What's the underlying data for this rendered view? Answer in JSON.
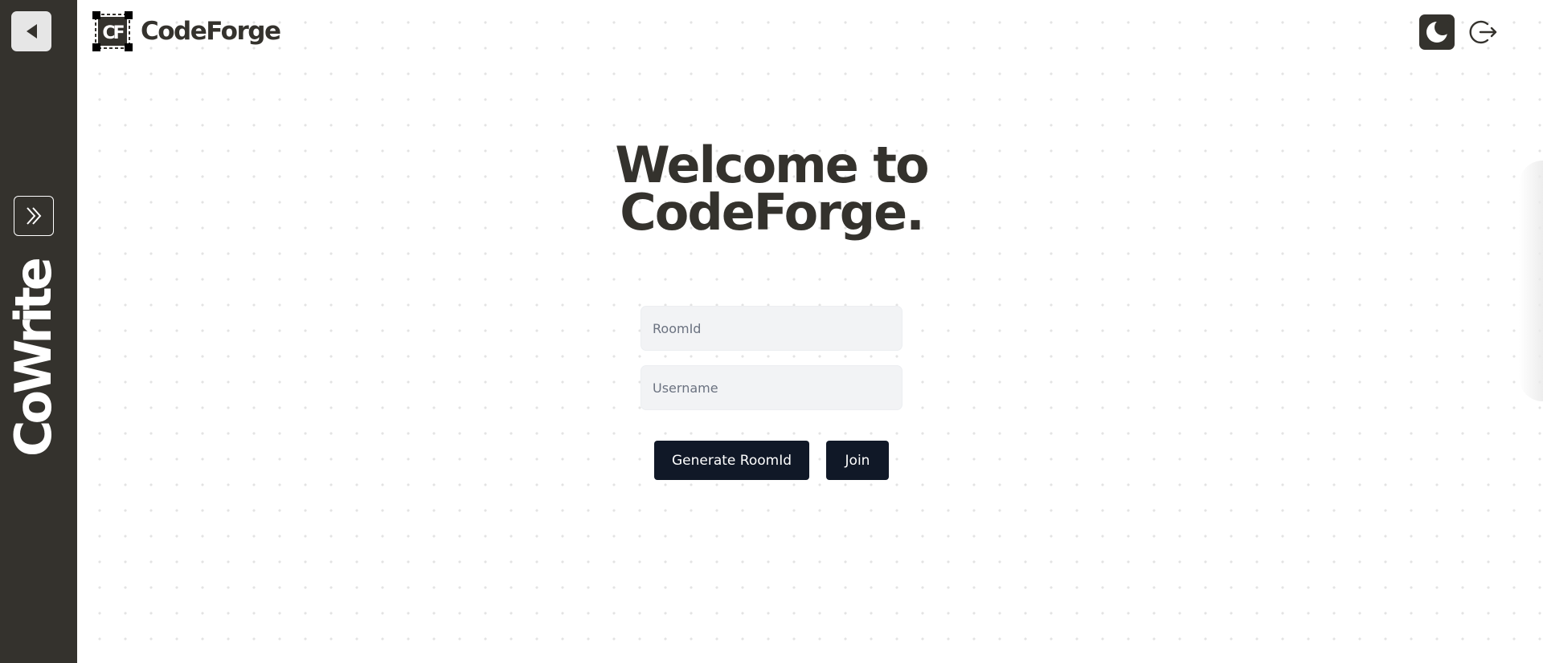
{
  "app": {
    "name": "CodeForge",
    "logo_letters": "CF"
  },
  "sidebar": {
    "brand": "CoWrite",
    "back_icon": "triangle-left-icon",
    "expand_icon": "double-chevron-right-icon"
  },
  "header": {
    "theme_toggle_icon": "moon-icon",
    "logout_icon": "logout-icon"
  },
  "main": {
    "headline_line1": "Welcome to",
    "headline_line2": "CodeForge.",
    "room_placeholder": "RoomId",
    "username_placeholder": "Username",
    "generate_label": "Generate RoomId",
    "join_label": "Join"
  },
  "colors": {
    "sidebar_bg": "#34322d",
    "text_dark": "#34322d",
    "button_bg": "#101827",
    "input_bg": "#f2f3f5"
  }
}
